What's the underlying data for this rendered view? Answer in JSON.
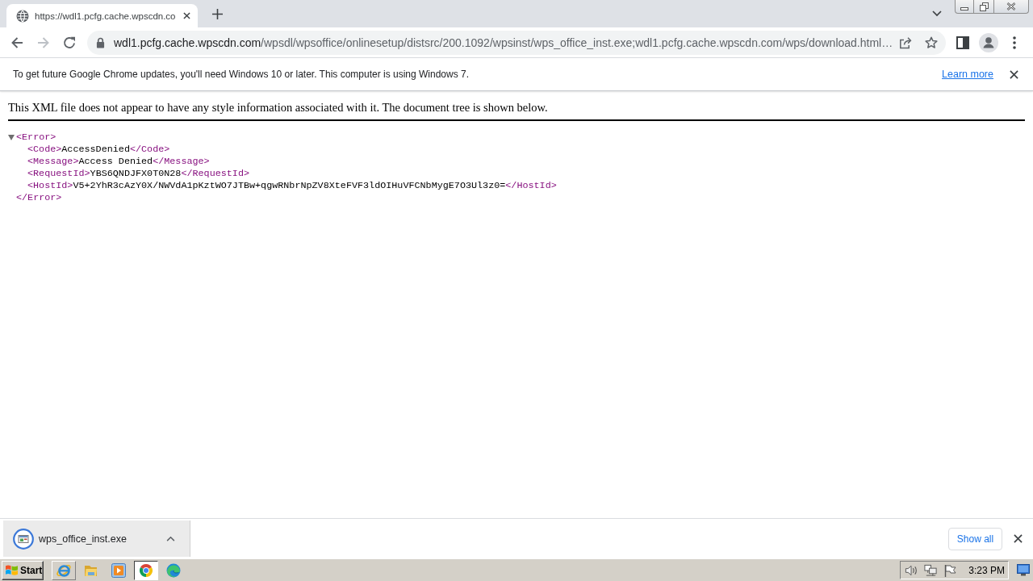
{
  "tabs": [
    {
      "title": "https://wdl1.pcfg.cache.wpscdn.co",
      "selected": true
    }
  ],
  "toolbar": {
    "nav_buttons": [
      {
        "kind": "back",
        "disabled": false
      },
      {
        "kind": "forward",
        "disabled": true
      },
      {
        "kind": "reload",
        "disabled": false
      }
    ]
  },
  "address_bar": {
    "host": "wdl1.pcfg.cache.wpscdn.com",
    "path": "/wpsdl/wpsoffice/onlinesetup/distsrc/200.1092/wpsinst/wps_office_inst.exe;wdl1.pcfg.cache.wpscdn.com/wps/download.html…"
  },
  "info_bar": {
    "message": "To get future Google Chrome updates, you'll need Windows 10 or later. This computer is using Windows 7.",
    "link": "Learn more"
  },
  "xml_viewer": {
    "notice": "This XML file does not appear to have any style information associated with it. The document tree is shown below.",
    "tree": {
      "open": "<Error>",
      "close": "</Error>",
      "expanded": true,
      "children": [
        {
          "open": "<Code>",
          "text": "AccessDenied",
          "close": "</Code>"
        },
        {
          "open": "<Message>",
          "text": "Access Denied",
          "close": "</Message>"
        },
        {
          "open": "<RequestId>",
          "text": "YBS6QNDJFX0T0N28",
          "close": "</RequestId>"
        },
        {
          "open": "<HostId>",
          "text": "V5+2YhR3cAzY0X/NWVdA1pKztWO7JTBw+qgwRNbrNpZV8XteFVF3ldOIHuVFCNbMygE7O3Ul3z0=",
          "close": "</HostId>"
        }
      ]
    }
  },
  "download_shelf": {
    "items": [
      {
        "filename": "wps_office_inst.exe"
      }
    ],
    "show_all": "Show all"
  },
  "taskbar": {
    "start": "Start",
    "apps": [
      {
        "kind": "eglobe",
        "selected": false,
        "raised": true
      },
      {
        "kind": "folder",
        "selected": false,
        "raised": false
      },
      {
        "kind": "player",
        "selected": false,
        "raised": false
      },
      {
        "kind": "ringlogo",
        "selected": true,
        "raised": false
      },
      {
        "kind": "wavelogo",
        "selected": false,
        "raised": false
      }
    ],
    "clock": "3:23 PM"
  }
}
